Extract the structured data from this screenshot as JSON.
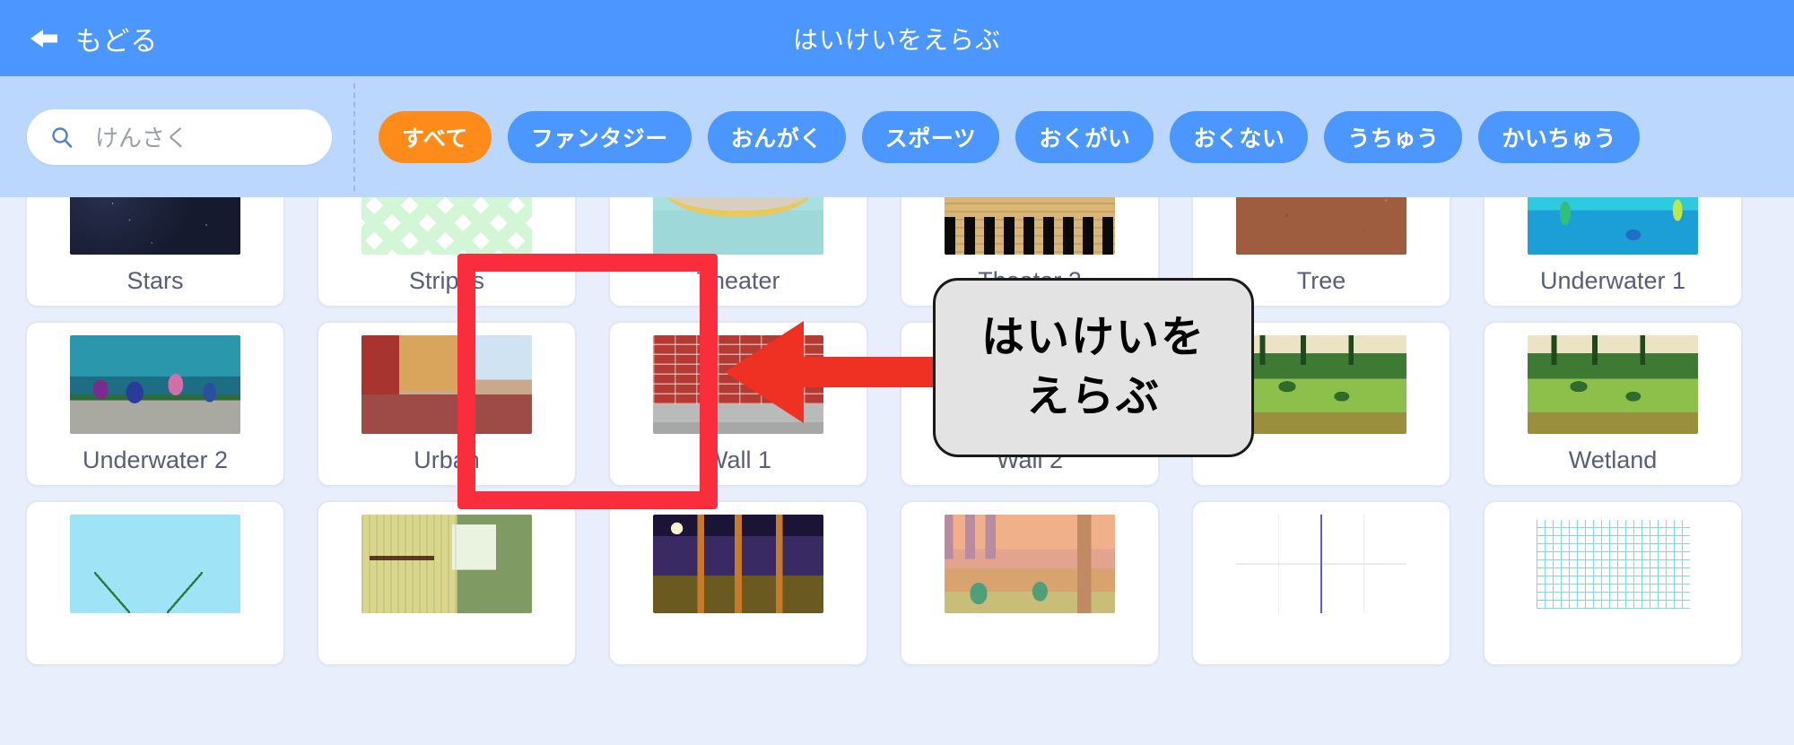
{
  "topbar": {
    "back_label": "もどる",
    "back_icon": "arrow-left-icon",
    "title": "はいけいをえらぶ",
    "bg_color": "#4c97ff"
  },
  "filterbar": {
    "bg_color": "#bcd7fe",
    "search": {
      "icon": "search-icon",
      "placeholder": "けんさく",
      "value": ""
    },
    "chips": [
      {
        "label": "すべて",
        "selected": true
      },
      {
        "label": "ファンタジー",
        "selected": false
      },
      {
        "label": "おんがく",
        "selected": false
      },
      {
        "label": "スポーツ",
        "selected": false
      },
      {
        "label": "おくがい",
        "selected": false
      },
      {
        "label": "おくない",
        "selected": false
      },
      {
        "label": "うちゅう",
        "selected": false
      },
      {
        "label": "かいちゅう",
        "selected": false
      }
    ],
    "selected_chip_color": "#ff8c1a",
    "chip_color": "#4c97ff"
  },
  "grid": {
    "rows": [
      {
        "cards": [
          {
            "label": "Stars",
            "art": "th-stars"
          },
          {
            "label": "Stripes",
            "art": "th-stripes"
          },
          {
            "label": "Theater",
            "art": "th-theater"
          },
          {
            "label": "Theater 2",
            "art": "th-theater2"
          },
          {
            "label": "Tree",
            "art": "th-tree"
          },
          {
            "label": "Underwater 1",
            "art": "th-uw1"
          }
        ]
      },
      {
        "cards": [
          {
            "label": "Underwater 2",
            "art": "th-uw2"
          },
          {
            "label": "Urban",
            "art": "th-urban"
          },
          {
            "label": "Wall 1",
            "art": "th-wall1",
            "highlighted": true
          },
          {
            "label": "Wall 2",
            "art": "th-wall2"
          },
          {
            "label": "",
            "art": "th-wetland"
          },
          {
            "label": "Wetland",
            "art": "th-wetland"
          }
        ]
      },
      {
        "cards": [
          {
            "label": "",
            "art": "th-blue"
          },
          {
            "label": "",
            "art": "th-room"
          },
          {
            "label": "",
            "art": "th-night"
          },
          {
            "label": "",
            "art": "th-sunset"
          },
          {
            "label": "",
            "art": "th-graph"
          },
          {
            "label": "",
            "art": "th-gridpaper"
          }
        ]
      }
    ]
  },
  "annotation": {
    "highlight_color": "#fa2d3c",
    "arrow_icon": "arrow-left-icon",
    "callout_line1": "はいけいを",
    "callout_line2": "えらぶ",
    "callout_bg": "#e3e3e3"
  }
}
